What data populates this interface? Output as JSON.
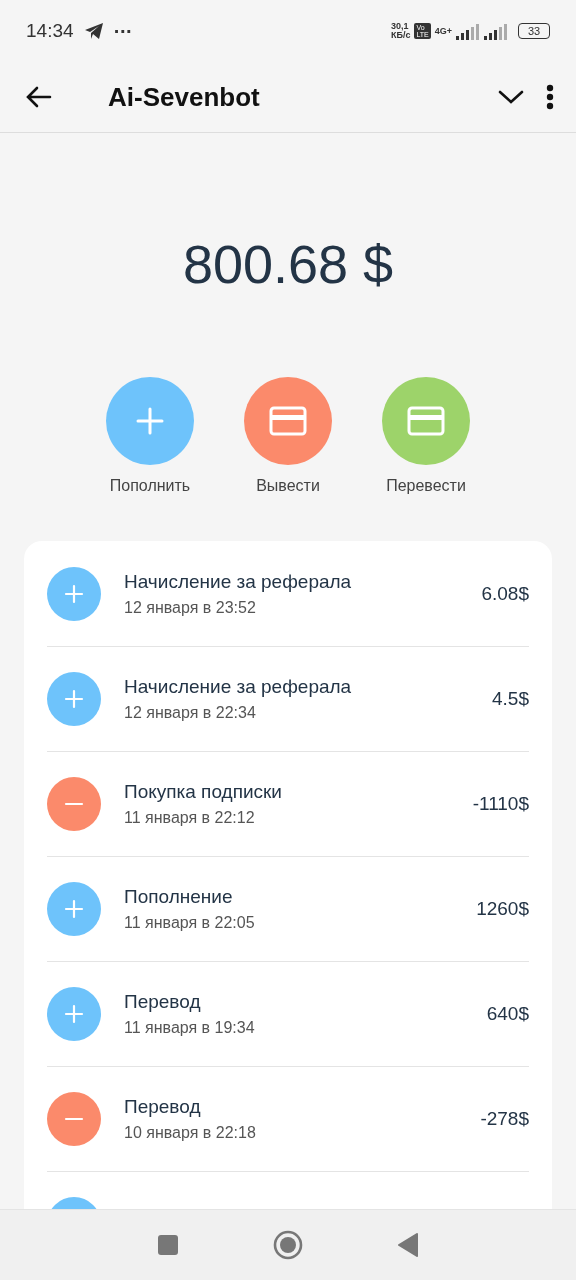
{
  "status_bar": {
    "time": "14:34",
    "more": "···",
    "speed": [
      "30,1",
      "КБ/с"
    ],
    "volte": [
      "Vo",
      "LTE"
    ],
    "network": "4G+",
    "battery": "33"
  },
  "app_bar": {
    "title": "Ai-Sevenbot"
  },
  "balance": "800.68 $",
  "actions": [
    {
      "kind": "plus",
      "label": "Пополнить",
      "color": "#6ec3fb"
    },
    {
      "kind": "card",
      "label": "Вывести",
      "color": "#fb8a6b"
    },
    {
      "kind": "card",
      "label": "Перевести",
      "color": "#9dd36a"
    }
  ],
  "transactions": [
    {
      "kind": "plus",
      "title": "Начисление за реферала",
      "date": "12 января в 23:52",
      "amount": "6.08$"
    },
    {
      "kind": "plus",
      "title": "Начисление за реферала",
      "date": "12 января в 22:34",
      "amount": "4.5$"
    },
    {
      "kind": "minus",
      "title": "Покупка подписки",
      "date": "11 января в 22:12",
      "amount": "-1110$"
    },
    {
      "kind": "plus",
      "title": "Пополнение",
      "date": "11 января в 22:05",
      "amount": "1260$"
    },
    {
      "kind": "plus",
      "title": "Перевод",
      "date": "11 января в 19:34",
      "amount": "640$"
    },
    {
      "kind": "minus",
      "title": "Перевод",
      "date": "10 января в 22:18",
      "amount": "-278$"
    },
    {
      "kind": "plus"
    }
  ]
}
